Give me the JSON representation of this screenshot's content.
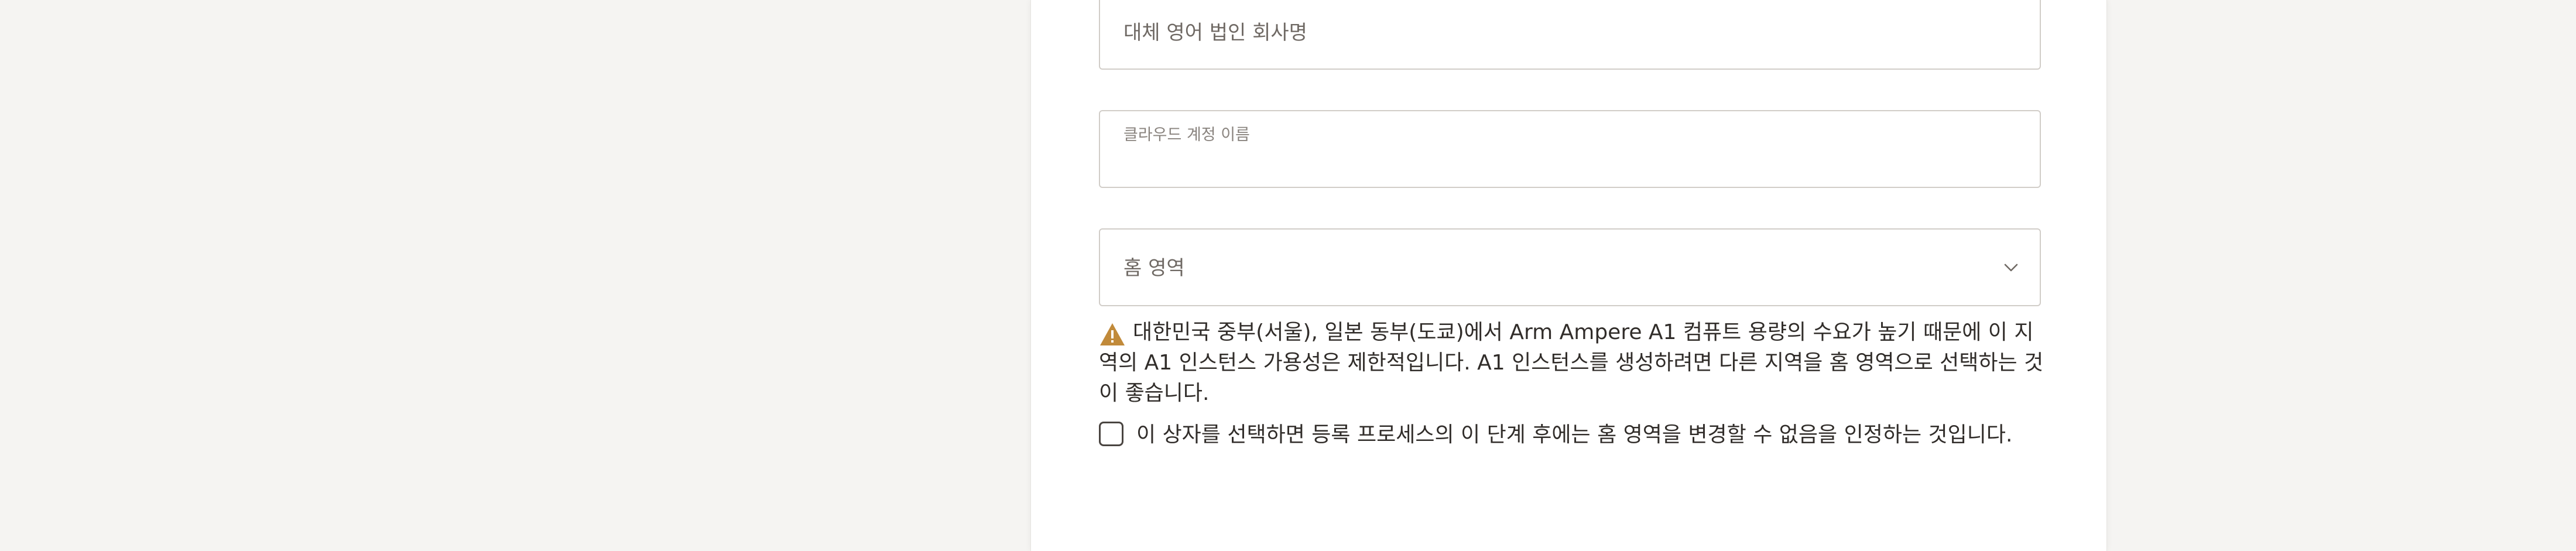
{
  "form": {
    "alt_company_name_placeholder": "대체 영어 법인 회사명",
    "cloud_account_label": "클라우드 계정 이름",
    "cloud_account_value": "",
    "home_region_placeholder": "홈 영역",
    "home_region_icon": "chevron-down-icon",
    "warning_icon": "warning-triangle-icon",
    "warning_icon_color": "#c18a3a",
    "warning_text": "대한민국 중부(서울), 일본 동부(도쿄)에서 Arm Ampere A1 컴퓨트 용량의 수요가 높기 때문에 이 지역의 A1 인스턴스 가용성은 제한적입니다. A1 인스턴스를 생성하려면 다른 지역을 홈 영역으로 선택하는 것이 좋습니다.",
    "acknowledge_text": "이 상자를 선택하면 등록 프로세스의 이 단계 후에는 홈 영역을 변경할 수 없음을 인정하는 것입니다.",
    "acknowledge_checked": false
  },
  "colors": {
    "page_background": "#f5f4f2",
    "card_background": "#ffffff",
    "field_border": "#d1cdc8",
    "text": "#312d2a",
    "muted_text": "#6f6964"
  }
}
